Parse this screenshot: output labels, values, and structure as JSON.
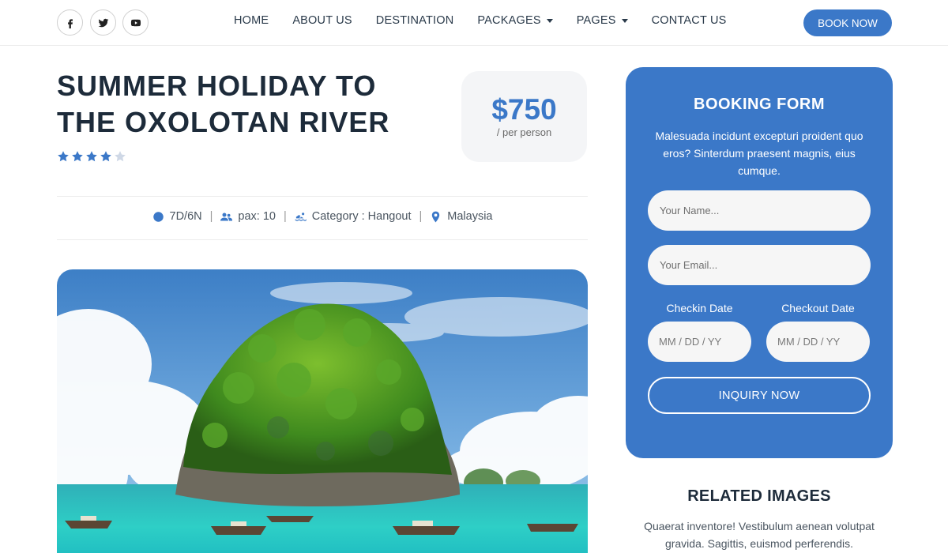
{
  "header": {
    "social": [
      {
        "name": "facebook-icon"
      },
      {
        "name": "twitter-icon"
      },
      {
        "name": "youtube-icon"
      }
    ],
    "nav": [
      {
        "label": "HOME",
        "dropdown": false
      },
      {
        "label": "ABOUT US",
        "dropdown": false
      },
      {
        "label": "DESTINATION",
        "dropdown": false
      },
      {
        "label": "PACKAGES",
        "dropdown": true
      },
      {
        "label": "PAGES",
        "dropdown": true
      },
      {
        "label": "CONTACT US",
        "dropdown": false
      }
    ],
    "book_now": "BOOK NOW"
  },
  "tour": {
    "title_line1": "SUMMER HOLIDAY TO",
    "title_line2": "THE OXOLOTAN RIVER",
    "rating": 4,
    "rating_max": 5,
    "price": "$750",
    "price_unit": "/ per person",
    "meta": {
      "duration": "7D/6N",
      "pax": "pax: 10",
      "category": "Category : Hangout",
      "location": "Malaysia"
    }
  },
  "booking": {
    "title": "BOOKING FORM",
    "description": "Malesuada incidunt excepturi proident quo eros? Sinterdum praesent magnis, eius cumque.",
    "name_placeholder": "Your Name...",
    "email_placeholder": "Your Email...",
    "checkin_label": "Checkin Date",
    "checkout_label": "Checkout Date",
    "checkin_placeholder": "MM / DD / YY",
    "checkout_placeholder": "MM / DD / YY",
    "submit": "INQUIRY NOW"
  },
  "related": {
    "title": "RELATED IMAGES",
    "description": "Quaerat inventore! Vestibulum aenean volutpat gravida. Sagittis, euismod perferendis."
  },
  "colors": {
    "accent": "#3b78c8",
    "heading": "#1d2b3a"
  }
}
